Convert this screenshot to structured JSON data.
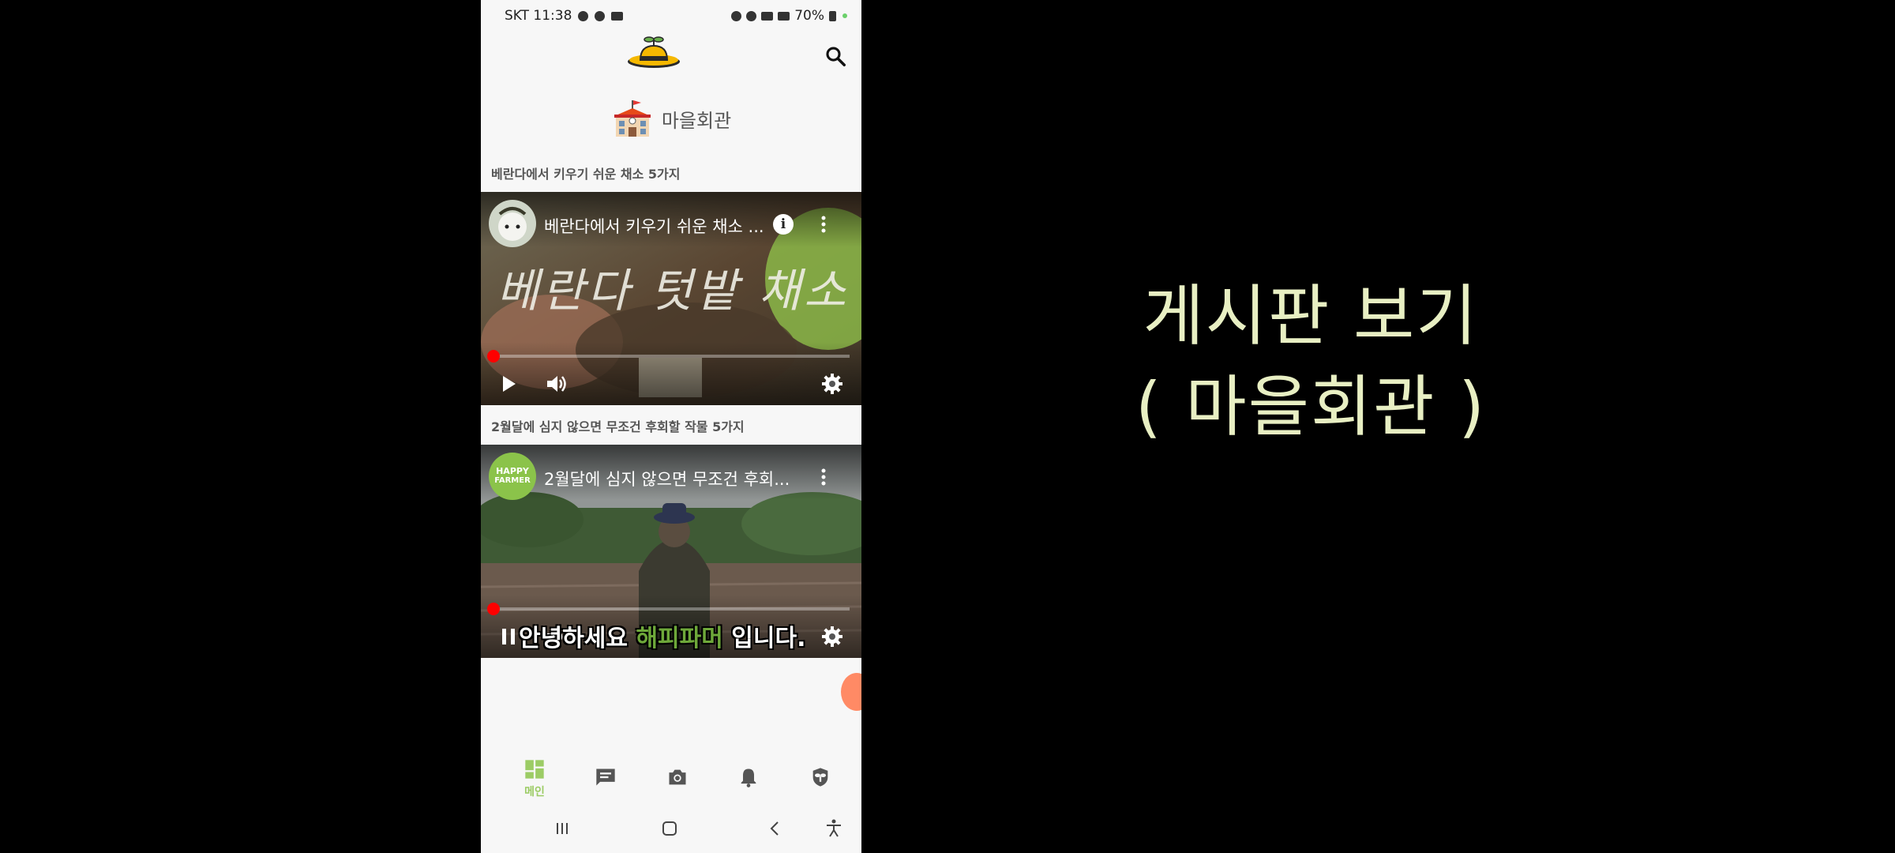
{
  "status_bar": {
    "carrier_time": "SKT 11:38",
    "battery": "70%"
  },
  "header": {
    "logo": "hat-sprout-logo",
    "search_icon": "search-icon"
  },
  "section": {
    "icon": "school-house-icon",
    "title": "마을회관"
  },
  "posts": [
    {
      "title": "베란다에서 키우기 쉬운 채소 5가지",
      "video_title": "베란다에서 키우기 쉬운 채소 ...",
      "overlay_text": "베란다 텃밭 채소",
      "state": "paused"
    },
    {
      "title": "2월달에 심지 않으면 무조건 후회할 작물 5가지",
      "video_title": "2월달에 심지 않으면 무조건 후회...",
      "channel_badge_line1": "HAPPY",
      "channel_badge_line2": "FARMER",
      "caption_pre": "안녕하세요 ",
      "caption_highlight": "해피파머",
      "caption_post": " 입니다.",
      "state": "playing"
    }
  ],
  "bottom_nav": {
    "items": [
      {
        "icon": "dashboard-icon",
        "label": "메인",
        "active": true
      },
      {
        "icon": "chat-icon",
        "label": ""
      },
      {
        "icon": "camera-icon",
        "label": ""
      },
      {
        "icon": "bell-icon",
        "label": ""
      },
      {
        "icon": "plant-badge-icon",
        "label": ""
      }
    ]
  },
  "colors": {
    "accent_green": "#9ccc65",
    "red_progress": "#ff0000",
    "right_text": "#e8efc3"
  },
  "right_caption": {
    "line1": "게시판 보기",
    "line2": "( 마을회관 )"
  }
}
